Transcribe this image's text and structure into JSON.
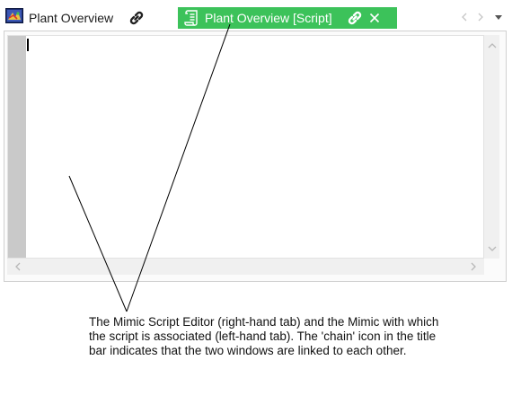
{
  "tabs": {
    "mimic": {
      "label": "Plant Overview",
      "icon": "mimic-icon",
      "link_icon": "chain-link-icon"
    },
    "script": {
      "label": "Plant Overview [Script]",
      "icon": "script-scroll-icon",
      "link_icon": "chain-link-icon",
      "close_icon": "close-icon",
      "color": "#3cc25a"
    }
  },
  "annotation": {
    "lines": [
      "The Mimic Script Editor (right-hand tab) and the Mimic with which",
      "the script is associated (left-hand tab). The 'chain' icon in the title",
      "bar indicates that the two windows are linked to each other."
    ]
  }
}
